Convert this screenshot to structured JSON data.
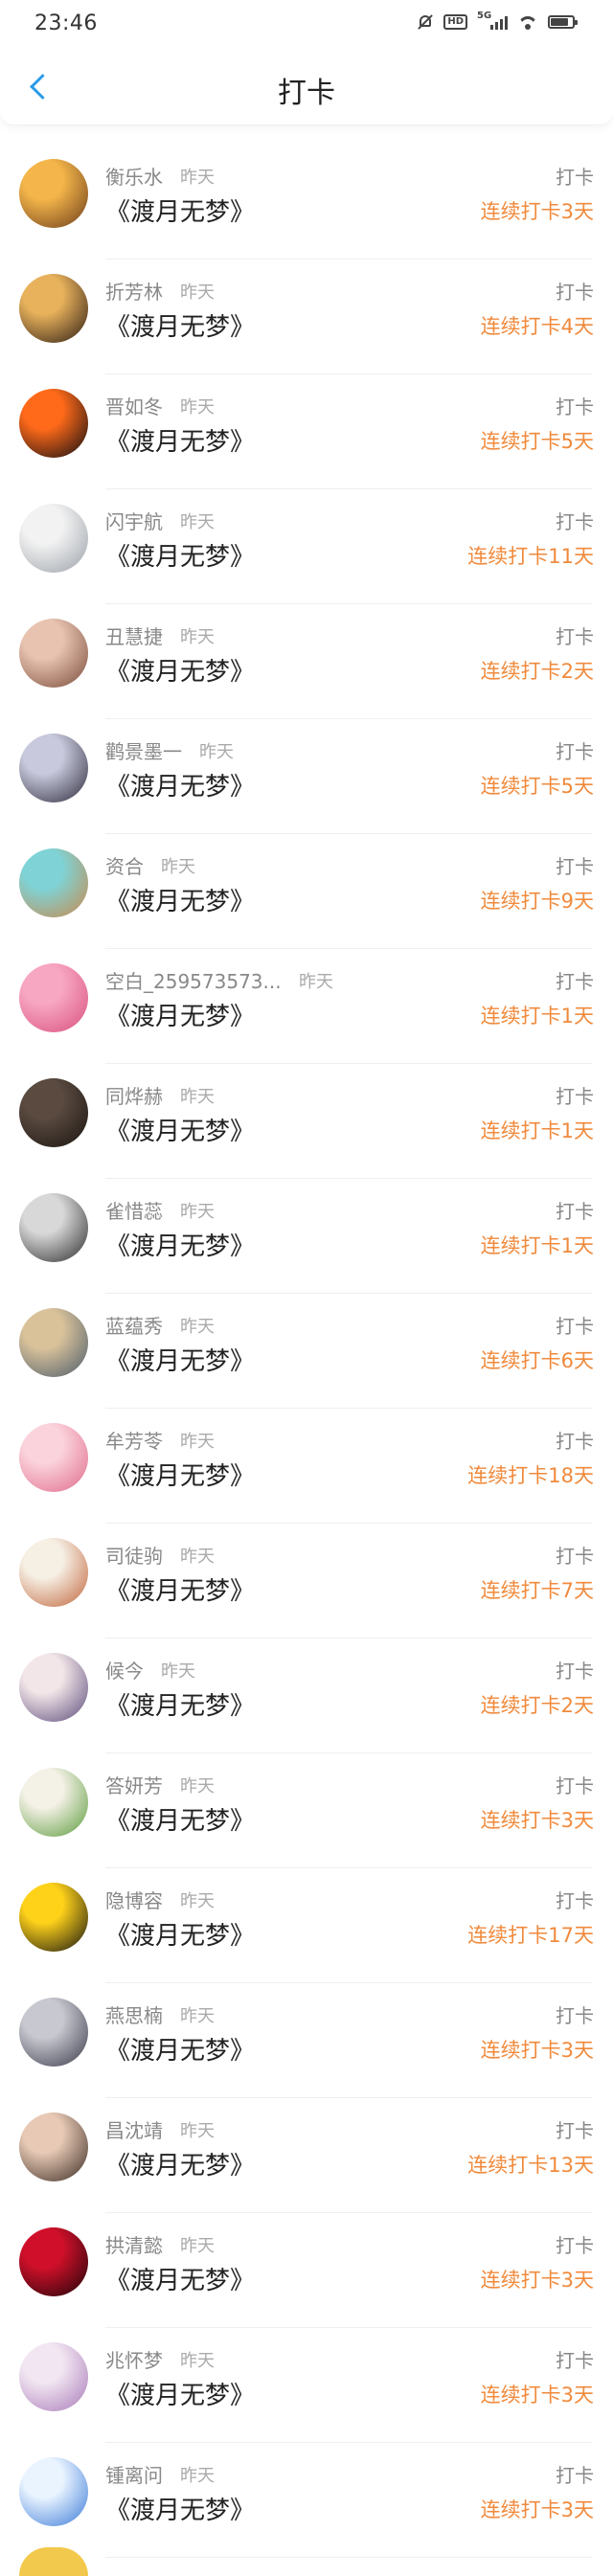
{
  "status_bar": {
    "time": "23:46",
    "network": "5G",
    "hd_label": "HD"
  },
  "header": {
    "title": "打卡",
    "back_icon": "chevron-left-icon"
  },
  "colors": {
    "accent_blue": "#2a9ae8",
    "streak_orange": "#f08a3c"
  },
  "list": [
    {
      "name": "衡乐水",
      "time": "昨天",
      "book": "《渡月无梦》",
      "action": "打卡",
      "streak": "连续打卡3天",
      "avatar": {
        "c1": "#f4b64a",
        "c2": "#6b3b1a"
      }
    },
    {
      "name": "折芳林",
      "time": "昨天",
      "book": "《渡月无梦》",
      "action": "打卡",
      "streak": "连续打卡4天",
      "avatar": {
        "c1": "#e8b25c",
        "c2": "#2a1a12"
      }
    },
    {
      "name": "晋如冬",
      "time": "昨天",
      "book": "《渡月无梦》",
      "action": "打卡",
      "streak": "连续打卡5天",
      "avatar": {
        "c1": "#ff6a1a",
        "c2": "#0a0a10"
      }
    },
    {
      "name": "闪宇航",
      "time": "昨天",
      "book": "《渡月无梦》",
      "action": "打卡",
      "streak": "连续打卡11天",
      "avatar": {
        "c1": "#f2f2f2",
        "c2": "#9aa0a8"
      }
    },
    {
      "name": "丑慧捷",
      "time": "昨天",
      "book": "《渡月无梦》",
      "action": "打卡",
      "streak": "连续打卡2天",
      "avatar": {
        "c1": "#e7c3b0",
        "c2": "#7a4a3a"
      }
    },
    {
      "name": "鹳景墨一",
      "time": "昨天",
      "book": "《渡月无梦》",
      "action": "打卡",
      "streak": "连续打卡5天",
      "avatar": {
        "c1": "#c9c9dd",
        "c2": "#2b2b3b"
      }
    },
    {
      "name": "资合",
      "time": "昨天",
      "book": "《渡月无梦》",
      "action": "打卡",
      "streak": "连续打卡9天",
      "avatar": {
        "c1": "#7fd3d6",
        "c2": "#c9884a"
      }
    },
    {
      "name": "空白_259573573...",
      "time": "昨天",
      "book": "《渡月无梦》",
      "action": "打卡",
      "streak": "连续打卡1天",
      "avatar": {
        "c1": "#f7a7c2",
        "c2": "#d9507e"
      }
    },
    {
      "name": "同烨赫",
      "time": "昨天",
      "book": "《渡月无梦》",
      "action": "打卡",
      "streak": "连续打卡1天",
      "avatar": {
        "c1": "#5a4a40",
        "c2": "#1a1410"
      }
    },
    {
      "name": "雀惜蕊",
      "time": "昨天",
      "book": "《渡月无梦》",
      "action": "打卡",
      "streak": "连续打卡1天",
      "avatar": {
        "c1": "#d8d8d8",
        "c2": "#2a2a2a"
      }
    },
    {
      "name": "蓝蕴秀",
      "time": "昨天",
      "book": "《渡月无梦》",
      "action": "打卡",
      "streak": "连续打卡6天",
      "avatar": {
        "c1": "#d9c29a",
        "c2": "#4a5a6a"
      }
    },
    {
      "name": "牟芳苓",
      "time": "昨天",
      "book": "《渡月无梦》",
      "action": "打卡",
      "streak": "连续打卡18天",
      "avatar": {
        "c1": "#fbd3dc",
        "c2": "#e06a8a"
      }
    },
    {
      "name": "司徒驹",
      "time": "昨天",
      "book": "《渡月无梦》",
      "action": "打卡",
      "streak": "连续打卡7天",
      "avatar": {
        "c1": "#f6efe4",
        "c2": "#c0643a"
      }
    },
    {
      "name": "候今",
      "time": "昨天",
      "book": "《渡月无梦》",
      "action": "打卡",
      "streak": "连续打卡2天",
      "avatar": {
        "c1": "#f3e6e8",
        "c2": "#5a4a7a"
      }
    },
    {
      "name": "答妍芳",
      "time": "昨天",
      "book": "《渡月无梦》",
      "action": "打卡",
      "streak": "连续打卡3天",
      "avatar": {
        "c1": "#f4f1e6",
        "c2": "#5a9a3a"
      }
    },
    {
      "name": "隐博容",
      "time": "昨天",
      "book": "《渡月无梦》",
      "action": "打卡",
      "streak": "连续打卡17天",
      "avatar": {
        "c1": "#ffd21a",
        "c2": "#111111"
      }
    },
    {
      "name": "燕思楠",
      "time": "昨天",
      "book": "《渡月无梦》",
      "action": "打卡",
      "streak": "连续打卡3天",
      "avatar": {
        "c1": "#c8c8d0",
        "c2": "#3a3a4a"
      }
    },
    {
      "name": "昌沈靖",
      "time": "昨天",
      "book": "《渡月无梦》",
      "action": "打卡",
      "streak": "连续打卡13天",
      "avatar": {
        "c1": "#e7c9b5",
        "c2": "#3a2a22"
      }
    },
    {
      "name": "拱清懿",
      "time": "昨天",
      "book": "《渡月无梦》",
      "action": "打卡",
      "streak": "连续打卡3天",
      "avatar": {
        "c1": "#d0102a",
        "c2": "#1a0508"
      }
    },
    {
      "name": "兆怀梦",
      "time": "昨天",
      "book": "《渡月无梦》",
      "action": "打卡",
      "streak": "连续打卡3天",
      "avatar": {
        "c1": "#f2e6f2",
        "c2": "#a87ab8"
      }
    },
    {
      "name": "锺离问",
      "time": "昨天",
      "book": "《渡月无梦》",
      "action": "打卡",
      "streak": "连续打卡3天",
      "avatar": {
        "c1": "#eaf4ff",
        "c2": "#3a7ad8"
      }
    }
  ]
}
